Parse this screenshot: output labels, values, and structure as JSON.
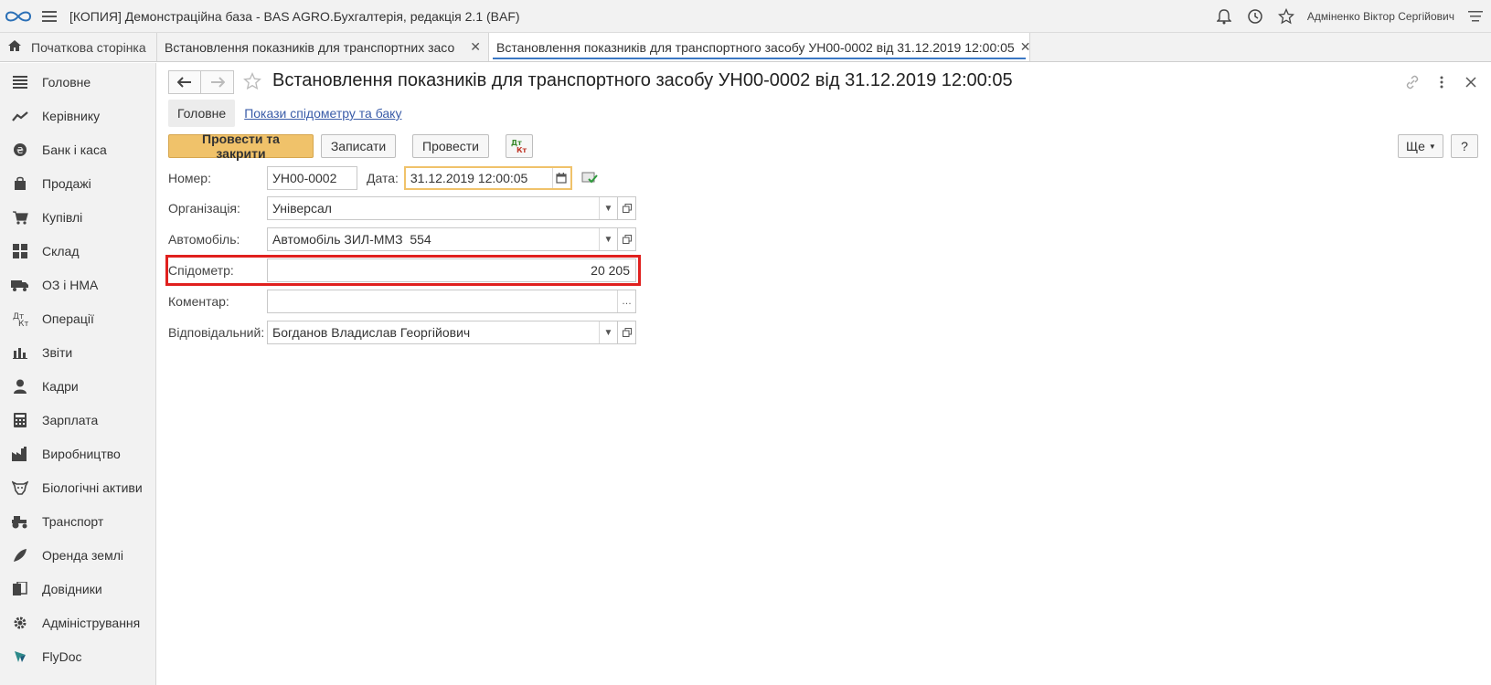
{
  "titlebar": {
    "title": "[КОПИЯ] Демонстраційна база - BAS AGRO.Бухгалтерія, редакція 2.1  (BAF)",
    "user": "Адміненко Віктор Сергійович"
  },
  "tabs": [
    {
      "label": "Початкова сторінка"
    },
    {
      "label": "Встановлення показників для транспортних засобів"
    },
    {
      "label": "Встановлення показників для транспортного засобу УН00-0002 від 31.12.2019 12:00:05"
    }
  ],
  "sidebar": {
    "items": [
      {
        "label": "Головне",
        "icon": "list-icon"
      },
      {
        "label": "Керівнику",
        "icon": "trend-icon"
      },
      {
        "label": "Банк і каса",
        "icon": "coin-icon"
      },
      {
        "label": "Продажі",
        "icon": "bag-icon"
      },
      {
        "label": "Купівлі",
        "icon": "cart-icon"
      },
      {
        "label": "Склад",
        "icon": "warehouse-icon"
      },
      {
        "label": "ОЗ і НМА",
        "icon": "truck-icon"
      },
      {
        "label": "Операції",
        "icon": "dtkt-icon"
      },
      {
        "label": "Звіти",
        "icon": "bar-chart-icon"
      },
      {
        "label": "Кадри",
        "icon": "person-icon"
      },
      {
        "label": "Зарплата",
        "icon": "calculator-icon"
      },
      {
        "label": "Виробництво",
        "icon": "factory-icon"
      },
      {
        "label": "Біологічні активи",
        "icon": "cow-icon"
      },
      {
        "label": "Транспорт",
        "icon": "tractor-icon"
      },
      {
        "label": "Оренда землі",
        "icon": "leaf-icon"
      },
      {
        "label": "Довідники",
        "icon": "books-icon"
      },
      {
        "label": "Адміністрування",
        "icon": "gear-icon"
      },
      {
        "label": "FlyDoc",
        "icon": "flydoc-icon"
      }
    ]
  },
  "doc": {
    "title": "Встановлення показників для транспортного засобу УН00-0002 від 31.12.2019 12:00:05",
    "subtab_main": "Головне",
    "subtab_link": "Покази спідометру та баку"
  },
  "commands": {
    "post_close": "Провести та закрити",
    "save": "Записати",
    "post": "Провести",
    "more": "Ще",
    "help": "?"
  },
  "form": {
    "number_label": "Номер:",
    "number_value": "УН00-0002",
    "date_label": "Дата:",
    "date_value": "31.12.2019 12:00:05",
    "org_label": "Організація:",
    "org_value": "Універсал",
    "car_label": "Автомобіль:",
    "car_value": "Автомобіль ЗИЛ-ММЗ  554",
    "speedo_label": "Спідометр:",
    "speedo_value": "20 205",
    "comment_label": "Коментар:",
    "comment_value": "",
    "resp_label": "Відповідальний:",
    "resp_value": "Богданов Владислав Георгійович"
  },
  "colors": {
    "accent": "#f0c26a",
    "highlight": "#e0201e",
    "link": "#3a5ca8",
    "active_tab_underline": "#3b78c4"
  }
}
